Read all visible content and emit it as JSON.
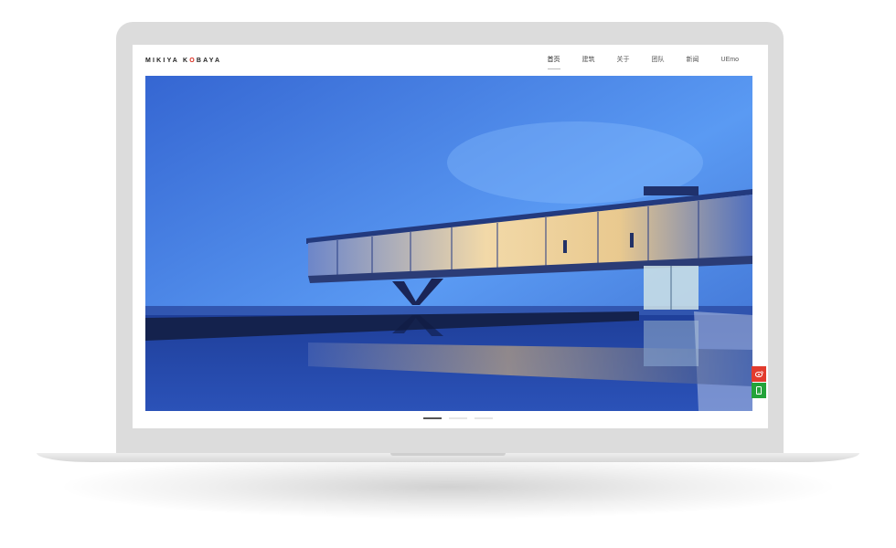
{
  "site": {
    "logo_part1": "MIKIYA K",
    "logo_accent": "O",
    "logo_part2": "BAYA",
    "accent_color": "#d9291c"
  },
  "nav": {
    "items": [
      {
        "label": "首页",
        "active": true
      },
      {
        "label": "建筑",
        "active": false
      },
      {
        "label": "关于",
        "active": false
      },
      {
        "label": "团队",
        "active": false
      },
      {
        "label": "新闻",
        "active": false
      },
      {
        "label": "UEmo",
        "active": false
      }
    ]
  },
  "hero": {
    "image_subject": "glass-house-cantilever-dusk"
  },
  "slider": {
    "count": 3,
    "active_index": 0
  },
  "side_tools": [
    {
      "icon": "weibo-icon",
      "color": "#e23b2e"
    },
    {
      "icon": "mobile-icon",
      "color": "#23a33a"
    }
  ]
}
